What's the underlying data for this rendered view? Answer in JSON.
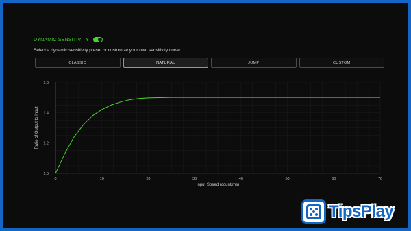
{
  "header": {
    "title": "DYNAMIC SENSITIVITY",
    "toggle_on": true,
    "subtitle": "Select a dynamic sensitivity preset or customize your own sensitivity curve."
  },
  "presets": [
    {
      "label": "CLASSIC",
      "active": false
    },
    {
      "label": "NATURAL",
      "active": true
    },
    {
      "label": "JUMP",
      "active": false
    },
    {
      "label": "CUSTOM",
      "active": false
    }
  ],
  "chart_data": {
    "type": "line",
    "xlabel": "Input Speed (count/ms)",
    "ylabel": "Ratio of Output to Input",
    "xlim": [
      0,
      70
    ],
    "ylim": [
      1.0,
      1.6
    ],
    "xticks": [
      0,
      10,
      20,
      30,
      40,
      50,
      60,
      70
    ],
    "yticks": [
      1.0,
      1.2,
      1.4,
      1.6
    ],
    "grid": true,
    "series": [
      {
        "color": "#44d62c",
        "x": [
          0,
          2,
          4,
          6,
          8,
          10,
          12,
          14,
          16,
          18,
          20,
          25,
          30,
          40,
          50,
          60,
          70
        ],
        "y": [
          1.0,
          1.13,
          1.24,
          1.32,
          1.38,
          1.42,
          1.45,
          1.47,
          1.485,
          1.493,
          1.497,
          1.5,
          1.5,
          1.5,
          1.5,
          1.5,
          1.5
        ]
      }
    ]
  },
  "watermark": {
    "text": "TipsPlay"
  },
  "colors": {
    "accent": "#44d62c",
    "brand": "#1565c4"
  }
}
